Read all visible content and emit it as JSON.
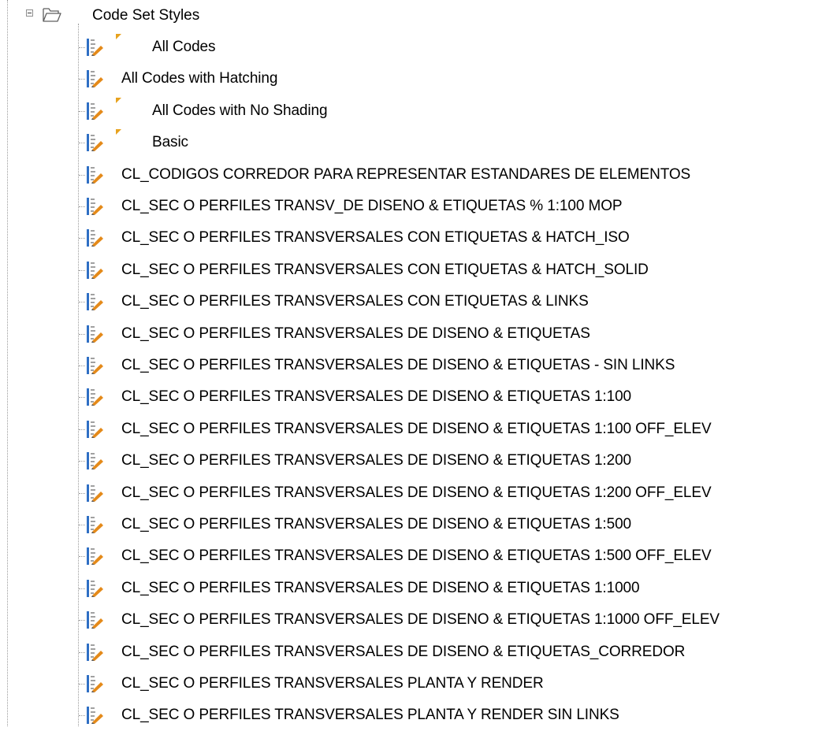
{
  "tree": {
    "root": {
      "label": "Code Set Styles",
      "expanded": true,
      "icon": "open-folder-icon"
    },
    "items": [
      {
        "label": "All Codes",
        "flagged": true
      },
      {
        "label": "All Codes with Hatching",
        "flagged": false
      },
      {
        "label": "All Codes with No Shading",
        "flagged": true
      },
      {
        "label": "Basic",
        "flagged": true
      },
      {
        "label": "CL_CODIGOS CORREDOR PARA REPRESENTAR ESTANDARES DE ELEMENTOS",
        "flagged": false
      },
      {
        "label": "CL_SEC O PERFILES TRANSV_DE DISENO & ETIQUETAS % 1:100 MOP",
        "flagged": false
      },
      {
        "label": "CL_SEC O PERFILES TRANSVERSALES CON ETIQUETAS & HATCH_ISO",
        "flagged": false
      },
      {
        "label": "CL_SEC O PERFILES TRANSVERSALES CON ETIQUETAS & HATCH_SOLID",
        "flagged": false
      },
      {
        "label": "CL_SEC O PERFILES TRANSVERSALES CON ETIQUETAS & LINKS",
        "flagged": false
      },
      {
        "label": "CL_SEC O PERFILES TRANSVERSALES DE DISENO & ETIQUETAS",
        "flagged": false
      },
      {
        "label": "CL_SEC O PERFILES TRANSVERSALES DE DISENO & ETIQUETAS - SIN LINKS",
        "flagged": false
      },
      {
        "label": "CL_SEC O PERFILES TRANSVERSALES DE DISENO & ETIQUETAS 1:100",
        "flagged": false
      },
      {
        "label": "CL_SEC O PERFILES TRANSVERSALES DE DISENO & ETIQUETAS 1:100 OFF_ELEV",
        "flagged": false
      },
      {
        "label": "CL_SEC O PERFILES TRANSVERSALES DE DISENO & ETIQUETAS 1:200",
        "flagged": false
      },
      {
        "label": "CL_SEC O PERFILES TRANSVERSALES DE DISENO & ETIQUETAS 1:200 OFF_ELEV",
        "flagged": false
      },
      {
        "label": "CL_SEC O PERFILES TRANSVERSALES DE DISENO & ETIQUETAS 1:500",
        "flagged": false
      },
      {
        "label": "CL_SEC O PERFILES TRANSVERSALES DE DISENO & ETIQUETAS 1:500 OFF_ELEV",
        "flagged": false
      },
      {
        "label": "CL_SEC O PERFILES TRANSVERSALES DE DISENO & ETIQUETAS 1:1000",
        "flagged": false
      },
      {
        "label": "CL_SEC O PERFILES TRANSVERSALES DE DISENO & ETIQUETAS 1:1000 OFF_ELEV",
        "flagged": false
      },
      {
        "label": "CL_SEC O PERFILES TRANSVERSALES DE DISENO & ETIQUETAS_CORREDOR",
        "flagged": false
      },
      {
        "label": "CL_SEC O PERFILES TRANSVERSALES PLANTA Y RENDER",
        "flagged": false
      },
      {
        "label": "CL_SEC O PERFILES TRANSVERSALES PLANTA Y RENDER SIN LINKS",
        "flagged": false
      }
    ],
    "item_icon": "code-set-style-icon",
    "flag_icon": "modified-flag-icon",
    "colors": {
      "flag": "#e7a21e",
      "connector": "#9a9a9a",
      "icon_blue": "#2f6fc4",
      "icon_gray": "#6e6e6e",
      "icon_orange": "#e48a1a"
    }
  }
}
